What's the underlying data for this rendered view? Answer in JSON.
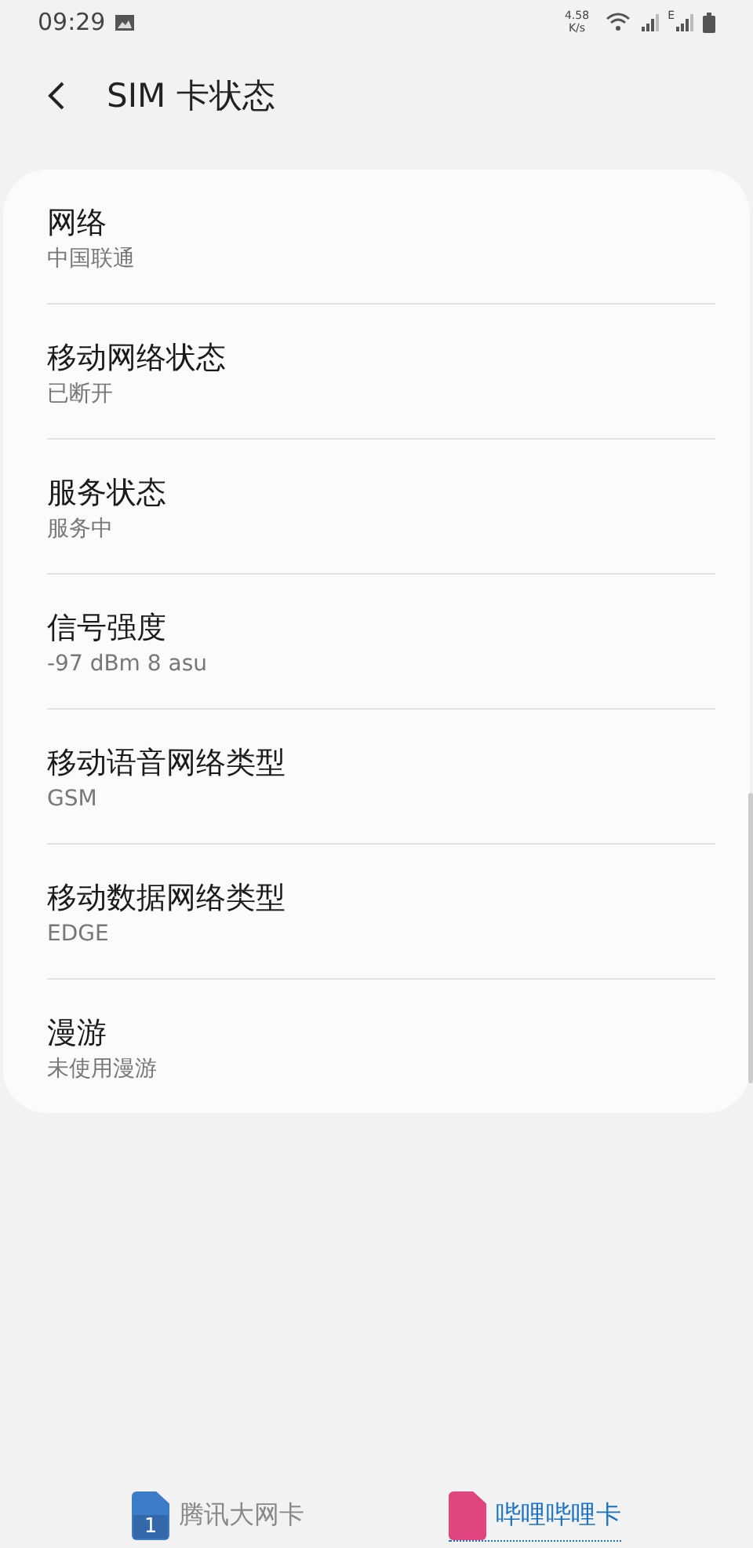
{
  "status_bar": {
    "time": "09:29",
    "speed": "4.58",
    "speed_unit": "K/s",
    "network_letter": "E"
  },
  "header": {
    "title": "SIM 卡状态"
  },
  "items": [
    {
      "title": "网络",
      "value": "中国联通"
    },
    {
      "title": "移动网络状态",
      "value": "已断开"
    },
    {
      "title": "服务状态",
      "value": "服务中"
    },
    {
      "title": "信号强度",
      "value": "-97 dBm 8 asu"
    },
    {
      "title": "移动语音网络类型",
      "value": "GSM"
    },
    {
      "title": "移动数据网络类型",
      "value": "EDGE"
    },
    {
      "title": "漫游",
      "value": "未使用漫游"
    }
  ],
  "sim_tabs": [
    {
      "number": "1",
      "label": "腾讯大网卡",
      "color": "#3d7cc9",
      "selected": false
    },
    {
      "label": "哔哩哔哩卡",
      "color": "#e0457f",
      "selected": true
    }
  ]
}
